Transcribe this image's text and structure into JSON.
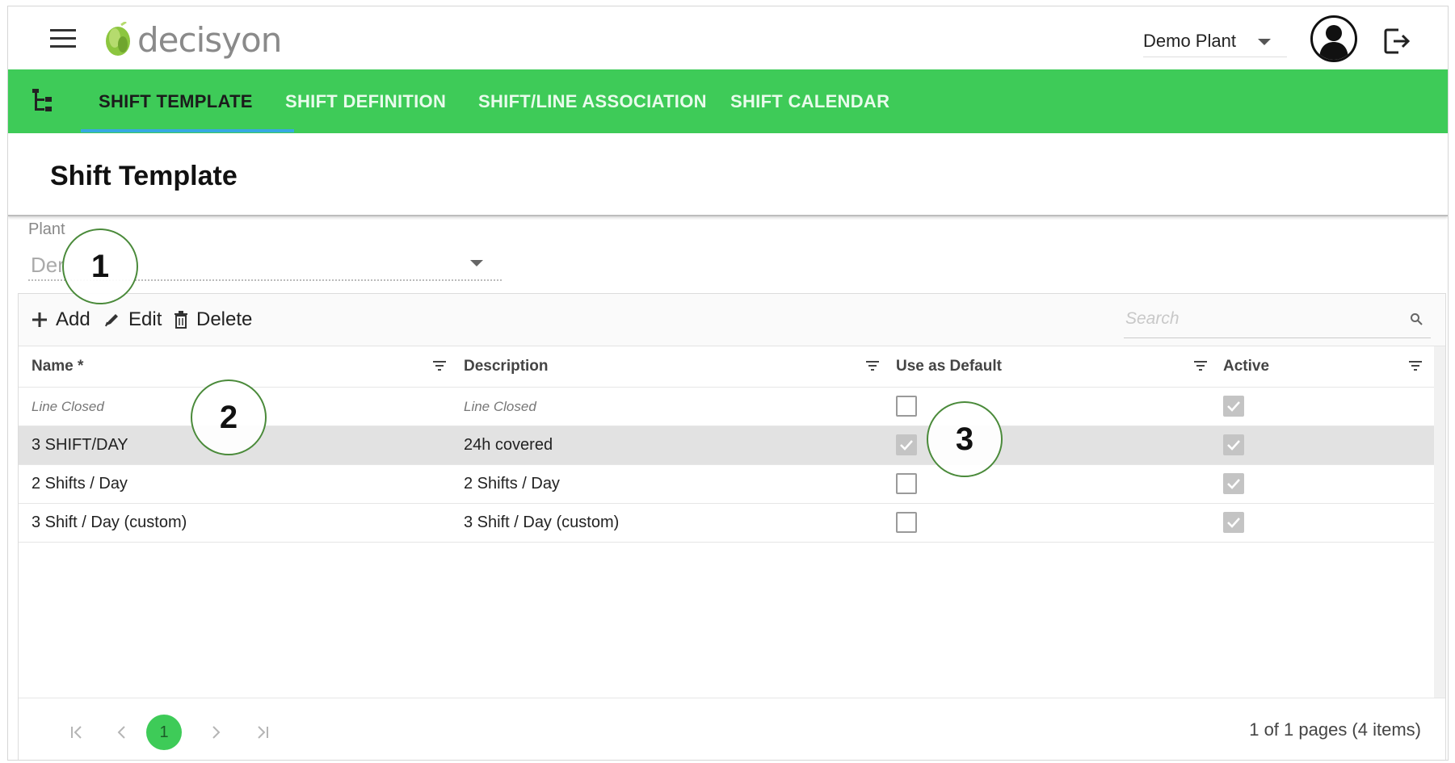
{
  "brand": {
    "logo_text": "decisyon",
    "logo_color": "#8cc63f"
  },
  "header": {
    "plant_select_value": "Demo Plant"
  },
  "nav": {
    "accent_color": "#3ecb58",
    "tabs": [
      {
        "label": "SHIFT TEMPLATE",
        "active": true
      },
      {
        "label": "SHIFT DEFINITION",
        "active": false
      },
      {
        "label": "SHIFT/LINE ASSOCIATION",
        "active": false
      },
      {
        "label": "SHIFT CALENDAR",
        "active": false
      }
    ]
  },
  "page": {
    "title": "Shift Template"
  },
  "plant_field": {
    "label": "Plant",
    "value": "Der"
  },
  "toolbar": {
    "add_label": "Add",
    "edit_label": "Edit",
    "delete_label": "Delete",
    "search_placeholder": "Search"
  },
  "table": {
    "columns": [
      "Name *",
      "Description",
      "Use as Default",
      "Active"
    ],
    "rows": [
      {
        "name": "Line Closed",
        "description": "Line Closed",
        "use_as_default": false,
        "active": true,
        "italic": true,
        "selected": false
      },
      {
        "name": "3 SHIFT/DAY",
        "description": "24h covered",
        "use_as_default": true,
        "active": true,
        "italic": false,
        "selected": true
      },
      {
        "name": "2 Shifts / Day",
        "description": "2 Shifts / Day",
        "use_as_default": false,
        "active": true,
        "italic": false,
        "selected": false
      },
      {
        "name": "3 Shift / Day (custom)",
        "description": "3 Shift / Day (custom)",
        "use_as_default": false,
        "active": true,
        "italic": false,
        "selected": false
      }
    ]
  },
  "pager": {
    "current_page": "1",
    "info": "1 of 1 pages (4 items)"
  },
  "callouts": [
    "1",
    "2",
    "3"
  ]
}
